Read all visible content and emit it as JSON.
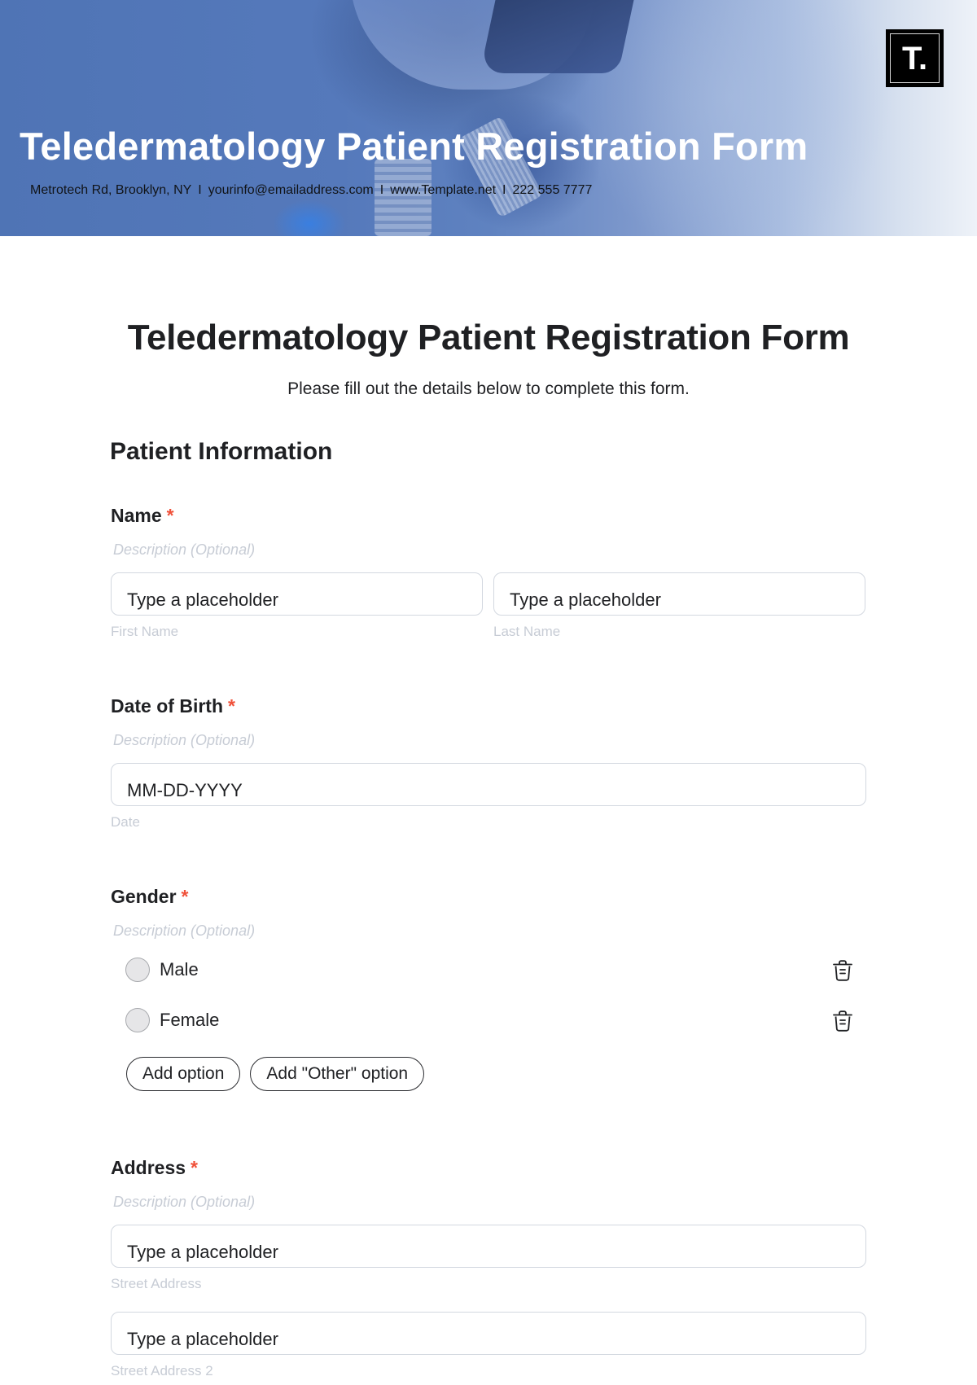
{
  "header": {
    "title": "Teledermatology Patient Registration Form",
    "contact": {
      "address": "Metrotech Rd, Brooklyn, NY",
      "email": "yourinfo@emailaddress.com",
      "website": "www.Template.net",
      "phone": "222 555 7777",
      "separator": "I"
    },
    "logo": {
      "glyph": "T.",
      "icon": "template-logo"
    }
  },
  "form": {
    "title": "Teledermatology Patient Registration Form",
    "subtitle": "Please fill out the details below to complete this form.",
    "section_title": "Patient Information",
    "required_marker": "*",
    "fields": {
      "name": {
        "label": "Name",
        "description": "Description (Optional)",
        "inputs": [
          {
            "placeholder": "Type a placeholder",
            "sublabel": "First Name"
          },
          {
            "placeholder": "Type a placeholder",
            "sublabel": "Last Name"
          }
        ]
      },
      "dob": {
        "label": "Date of Birth",
        "description": "Description (Optional)",
        "placeholder": "MM-DD-YYYY",
        "sublabel": "Date"
      },
      "gender": {
        "label": "Gender",
        "description": "Description (Optional)",
        "options": [
          {
            "label": "Male",
            "selected": false,
            "delete_icon": "trash-icon"
          },
          {
            "label": "Female",
            "selected": false,
            "delete_icon": "trash-icon"
          }
        ],
        "add_option_label": "Add option",
        "add_other_label": "Add \"Other\" option"
      },
      "address": {
        "label": "Address",
        "description": "Description (Optional)",
        "inputs": [
          {
            "placeholder": "Type a placeholder",
            "sublabel": "Street Address"
          },
          {
            "placeholder": "Type a placeholder",
            "sublabel": "Street Address 2"
          }
        ]
      }
    }
  }
}
